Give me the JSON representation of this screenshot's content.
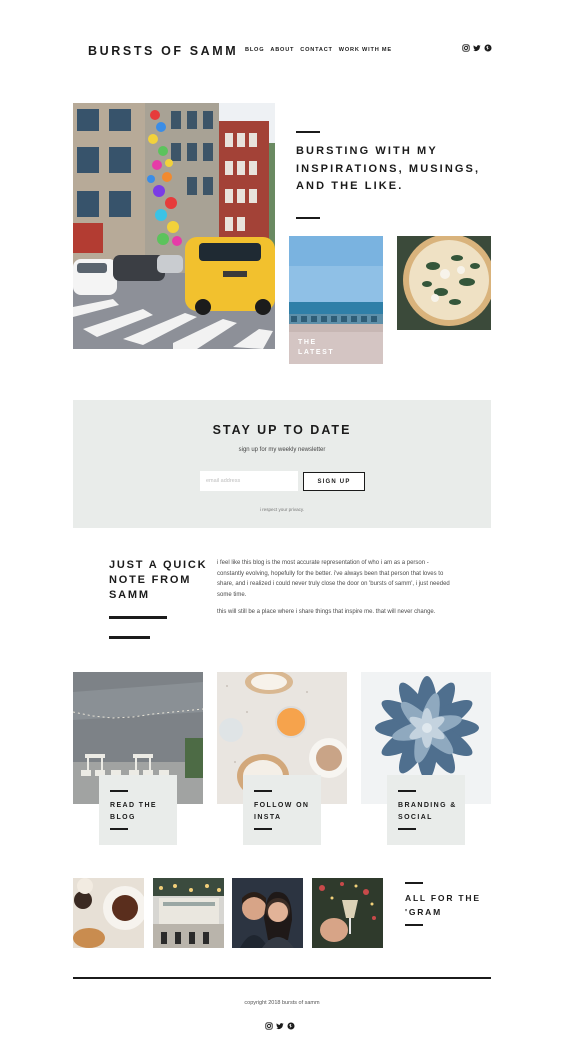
{
  "header": {
    "logo": "BURSTS OF SAMM",
    "nav": [
      "BLOG",
      "ABOUT",
      "CONTACT",
      "WORK WITH ME"
    ],
    "social_icons": [
      "instagram-icon",
      "twitter-icon",
      "pinterest-icon"
    ]
  },
  "hero": {
    "title": "BURSTING WITH MY INSPIRATIONS, MUSINGS, AND THE LIKE.",
    "latest_label_line1": "THE",
    "latest_label_line2": "LATEST"
  },
  "newsletter": {
    "title": "STAY UP TO DATE",
    "subtitle": "sign up for my weekly newsletter",
    "email_placeholder": "email address",
    "button_label": "SIGN UP",
    "privacy": "i respect your privacy."
  },
  "note": {
    "title": "JUST A QUICK NOTE FROM SAMM",
    "paragraph1": "i feel like this blog is the most accurate representation of who i am as a person - constantly evolving, hopefully for the better. i've always been that person that loves to share, and i realized i could never truly close the door on 'bursts of samm', i just needed some time.",
    "paragraph2": "this will still be a place where i share things that inspire me. that will never change."
  },
  "tiles": [
    {
      "line1": "READ THE",
      "line2": "BLOG"
    },
    {
      "line1": "FOLLOW ON",
      "line2": "INSTA"
    },
    {
      "line1": "BRANDING &",
      "line2": "SOCIAL"
    }
  ],
  "gram": {
    "title_line1": "ALL FOR THE",
    "title_line2": "'GRAM"
  },
  "footer": {
    "copyright": "copyright 2018 bursts of samm",
    "social_icons": [
      "instagram-icon",
      "twitter-icon",
      "pinterest-icon"
    ]
  },
  "colors": {
    "text": "#1b1b1b",
    "panel": "#e9ecea",
    "taxi": "#f2c12e",
    "sky": "#8fc0e6",
    "succulent": "#5f7e9a"
  }
}
